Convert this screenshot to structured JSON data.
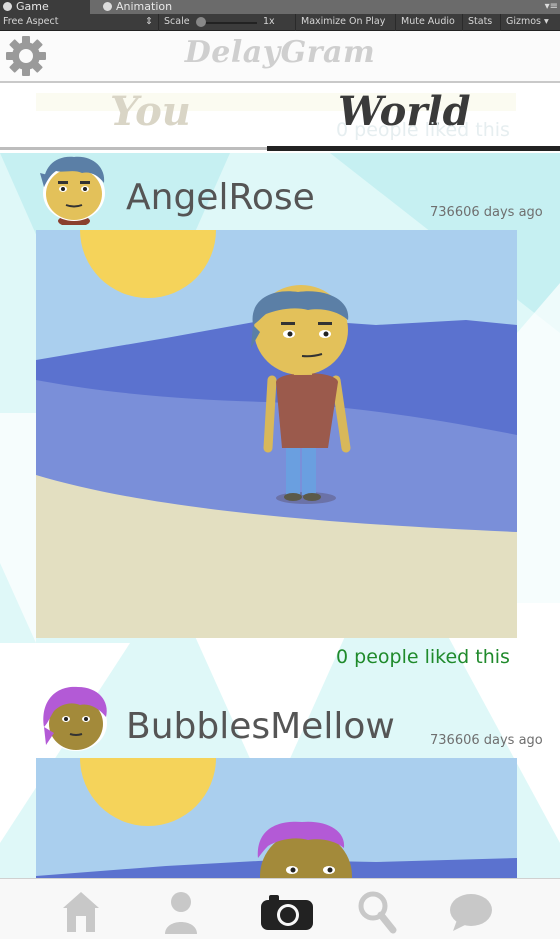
{
  "editor": {
    "tabs": [
      {
        "label": "Game",
        "active": true,
        "icon": "game-icon"
      },
      {
        "label": "Animation",
        "active": false,
        "icon": "animation-icon"
      }
    ],
    "toolbar": {
      "aspect": "Free Aspect",
      "scale_label": "Scale",
      "scale_value": "1x",
      "maximize": "Maximize On Play",
      "mute": "Mute Audio",
      "stats": "Stats",
      "gizmos": "Gizmos"
    }
  },
  "app": {
    "title": "DelayGram",
    "settings_icon": "gear-icon"
  },
  "tabs": {
    "you": "You",
    "world": "World",
    "active": "world"
  },
  "ghost_likes": "0 people liked this",
  "posts": [
    {
      "user": "AngelRose",
      "age": "736606 days ago",
      "likes": "0 people liked this",
      "avatar_hair": "#5b7fa6"
    },
    {
      "user": "BubblesMellow",
      "age": "736606 days ago",
      "avatar_hair": "#b35ad6"
    }
  ],
  "nav": {
    "items": [
      "home-icon",
      "profile-icon",
      "camera-icon",
      "search-icon",
      "chat-icon"
    ],
    "active": "camera-icon"
  },
  "colors": {
    "likes": "#1f8a2b",
    "sky": "#aacfee",
    "sun": "#f5d35a",
    "sea": "#5b72cf",
    "sand": "#e3dfc1"
  }
}
